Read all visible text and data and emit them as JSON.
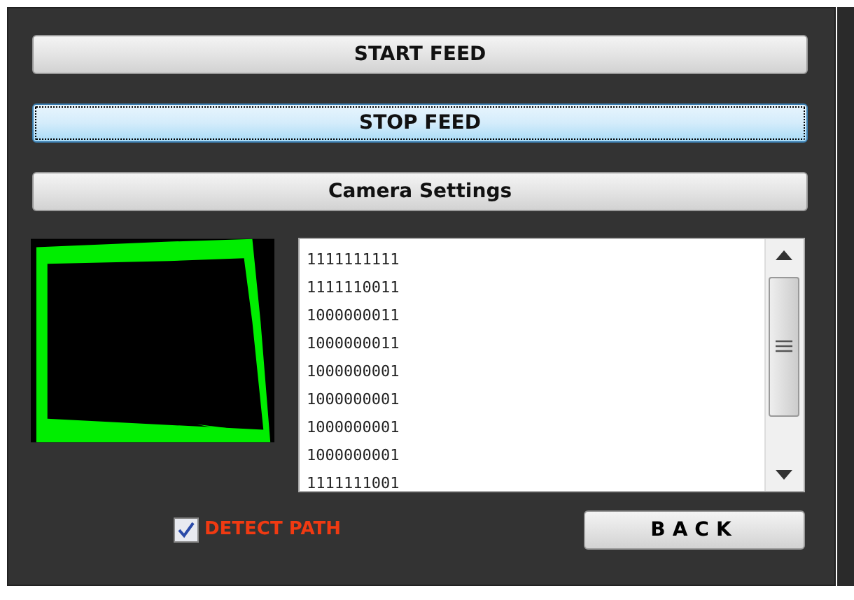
{
  "buttons": [
    {
      "label": "START FEED",
      "focused": false
    },
    {
      "label": "STOP FEED",
      "focused": true
    },
    {
      "label": "Camera Settings",
      "focused": false
    }
  ],
  "output_lines": [
    "1111111111",
    "1111110011",
    "1000000011",
    "1000000011",
    "1000000001",
    "1000000001",
    "1000000001",
    "1000000001",
    "1111111001"
  ],
  "detect_path": {
    "label": "DETECT PATH",
    "checked": true
  },
  "back_button": {
    "label": "BACK"
  }
}
